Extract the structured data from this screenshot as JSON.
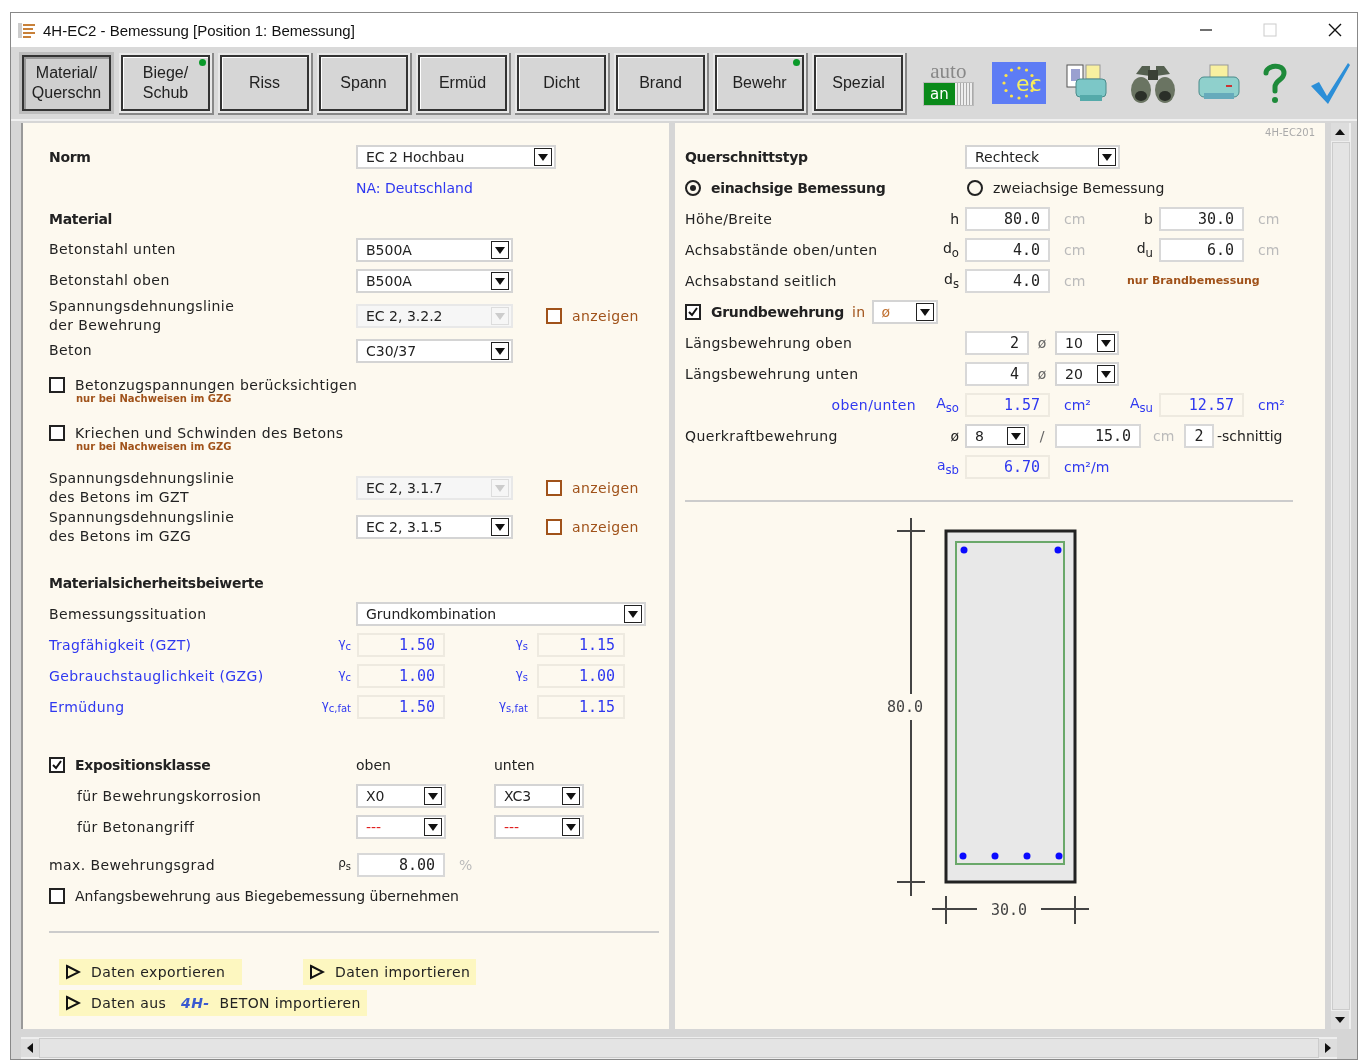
{
  "window": {
    "title": "4H-EC2 - Bemessung [Position 1: Bemessung]"
  },
  "tabs": [
    {
      "label": "Material/\nQuerschn",
      "selected": true,
      "marked": false
    },
    {
      "label": "Biege/\nSchub",
      "selected": false,
      "marked": true
    },
    {
      "label": "Riss",
      "selected": false,
      "marked": false
    },
    {
      "label": "Spann",
      "selected": false,
      "marked": false
    },
    {
      "label": "Ermüd",
      "selected": false,
      "marked": false
    },
    {
      "label": "Dicht",
      "selected": false,
      "marked": false
    },
    {
      "label": "Brand",
      "selected": false,
      "marked": false
    },
    {
      "label": "Bewehr",
      "selected": false,
      "marked": true
    },
    {
      "label": "Spezial",
      "selected": false,
      "marked": false
    }
  ],
  "toolbar": {
    "auto_label": "auto",
    "auto_switch": {
      "label": "an",
      "on": true
    },
    "ec_logo": "ec"
  },
  "left": {
    "norm": {
      "label": "Norm",
      "value": "EC 2 Hochbau",
      "note": "NA: Deutschland"
    },
    "material": {
      "heading": "Material",
      "rows": [
        {
          "kind": "select",
          "label": "Betonstahl unten",
          "value": "B500A",
          "disabled": false
        },
        {
          "kind": "select",
          "label": "Betonstahl oben",
          "value": "B500A",
          "disabled": false
        },
        {
          "kind": "select",
          "label": "Spannungsdehnungslinie\nder Bewehrung",
          "value": "EC 2, 3.2.2",
          "disabled": true,
          "show": {
            "label": "anzeigen",
            "checked": false
          }
        },
        {
          "kind": "select",
          "label": "Beton",
          "value": "C30/37",
          "disabled": false
        },
        {
          "kind": "check",
          "label": "Betonzugspannungen berücksichtigen",
          "note": "nur bei Nachweisen im GZG",
          "checked": false
        },
        {
          "kind": "check",
          "label": "Kriechen und Schwinden des Betons",
          "note": "nur bei Nachweisen im GZG",
          "checked": false
        },
        {
          "kind": "select",
          "label": "Spannungsdehnungslinie\ndes Betons im GZT",
          "value": "EC 2, 3.1.7",
          "disabled": true,
          "show": {
            "label": "anzeigen",
            "checked": false
          }
        },
        {
          "kind": "select",
          "label": "Spannungsdehnungslinie\ndes Betons im GZG",
          "value": "EC 2, 3.1.5",
          "disabled": false,
          "show": {
            "label": "anzeigen",
            "checked": false
          }
        }
      ]
    },
    "safety": {
      "heading": "Materialsicherheitsbeiwerte",
      "situation": {
        "label": "Bemessungssituation",
        "value": "Grundkombination"
      },
      "rows": [
        {
          "label": "Tragfähigkeit (GZT)",
          "sym_c": "γ$_{c}$",
          "c": "1.50",
          "sym_s": "γ$_{s}$",
          "s": "1.15"
        },
        {
          "label": "Gebrauchstauglichkeit (GZG)",
          "sym_c": "γ$_{c}$",
          "c": "1.00",
          "sym_s": "γ$_{s}$",
          "s": "1.00"
        },
        {
          "label": "Ermüdung",
          "sym_c": "γ$_{c,fat}$",
          "c": "1.50",
          "sym_s": "γ$_{s,fat}$",
          "s": "1.15"
        }
      ]
    },
    "exposure": {
      "label": "Expositionsklasse",
      "checked": true,
      "col_top": "oben",
      "col_bottom": "unten",
      "rows": [
        {
          "label": "für Bewehrungskorrosion",
          "top": "X0",
          "bottom": "XC3",
          "unset": false
        },
        {
          "label": "für Betonangriff",
          "top": "---",
          "bottom": "---",
          "unset": true
        }
      ]
    },
    "max_ratio": {
      "label": "max. Bewehrungsgrad",
      "symbol": "ρ$_{s}$",
      "value": "8.00",
      "unit": "%"
    },
    "adopt": {
      "label": "Anfangsbewehrung aus Biegebemessung übernehmen",
      "checked": false
    },
    "actions": [
      {
        "label": "Daten exportieren"
      },
      {
        "label": "Daten importieren"
      },
      {
        "label": "Daten aus",
        "logo": "4H-",
        "suffix": "BETON importieren"
      }
    ]
  },
  "right": {
    "stamp": "4H-EC201",
    "type": {
      "label": "Querschnittstyp",
      "value": "Rechteck"
    },
    "modes": [
      {
        "label": "einachsige Bemessung",
        "selected": true
      },
      {
        "label": "zweiachsige Bemessung",
        "selected": false
      }
    ],
    "dims": [
      {
        "label": "Höhe/Breite",
        "s1": "h",
        "v1": "80.0",
        "u1": "cm",
        "s2": "b",
        "v2": "30.0",
        "u2": "cm"
      },
      {
        "label": "Achsabstände oben/unten",
        "s1": "d$_{o}$",
        "v1": "4.0",
        "u1": "cm",
        "s2": "d$_{u}$",
        "v2": "6.0",
        "u2": "cm"
      },
      {
        "label": "Achsabstand seitlich",
        "s1": "d$_{s}$",
        "v1": "4.0",
        "u1": "cm",
        "note": "nur Brandbemessung"
      }
    ],
    "basic": {
      "label": "Grundbewehrung",
      "checked": true,
      "in": "in",
      "value": "ø"
    },
    "long": [
      {
        "label": "Längsbewehrung oben",
        "count": "2",
        "sym": "ø",
        "dia": "10"
      },
      {
        "label": "Längsbewehrung unten",
        "count": "4",
        "sym": "ø",
        "dia": "20"
      }
    ],
    "areas": {
      "label": "oben/unten",
      "s1": "A$_{so}$",
      "v1": "1.57",
      "u1": "cm²",
      "s2": "A$_{su}$",
      "v2": "12.57",
      "u2": "cm²"
    },
    "shear": {
      "label": "Querkraftbewehrung",
      "sym": "ø",
      "dia": "8",
      "slash": "/",
      "spacing": "15.0",
      "unit": "cm",
      "cuts": "2",
      "suffix": "-schnittig"
    },
    "asb": {
      "sym": "a$_{sb}$",
      "value": "6.70",
      "unit": "cm²/m"
    },
    "section": {
      "height_label": "80.0",
      "width_label": "30.0"
    }
  }
}
